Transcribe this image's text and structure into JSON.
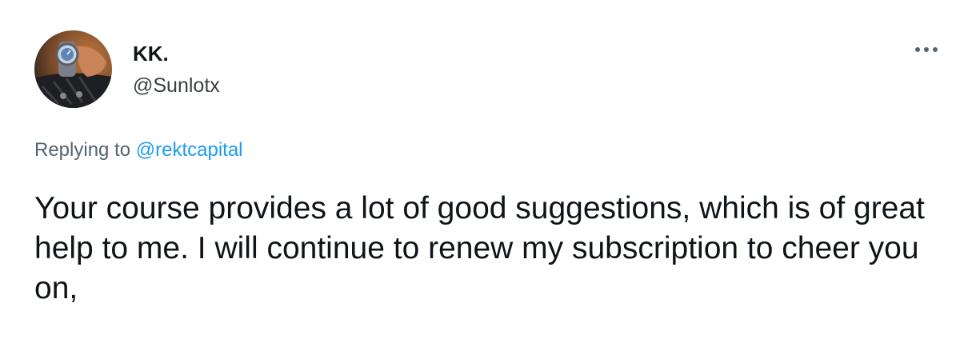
{
  "author": {
    "display_name": "KK.",
    "handle": "@Sunlotx",
    "avatar_icon": "profile-photo"
  },
  "more_icon": "more-dots-icon",
  "reply": {
    "prefix": "Replying to",
    "mention": "@rektcapital"
  },
  "tweet": {
    "text": "Your course provides a lot of good suggestions, which is of great help to me. I will continue to renew my subscription to cheer you on,"
  },
  "colors": {
    "text": "#0f1419",
    "secondary": "#536471",
    "link": "#1d9bf0"
  }
}
